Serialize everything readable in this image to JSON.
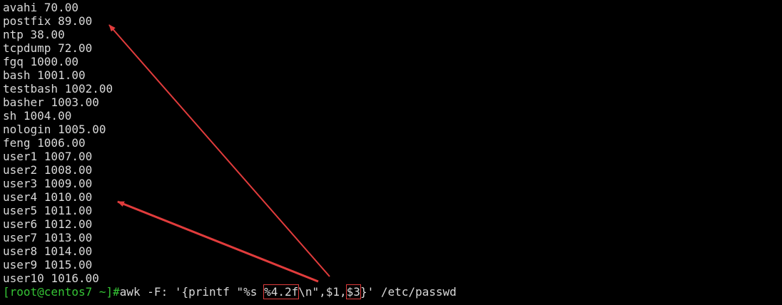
{
  "terminal": {
    "output_lines": [
      "avahi 70.00",
      "postfix 89.00",
      "ntp 38.00",
      "tcpdump 72.00",
      "fgq 1000.00",
      "bash 1001.00",
      "testbash 1002.00",
      "basher 1003.00",
      "sh 1004.00",
      "nologin 1005.00",
      "feng 1006.00",
      "user1 1007.00",
      "user2 1008.00",
      "user3 1009.00",
      "user4 1010.00",
      "user5 1011.00",
      "user6 1012.00",
      "user7 1013.00",
      "user8 1014.00",
      "user9 1015.00",
      "user10 1016.00"
    ],
    "prompt": "[root@centos7 ~]#",
    "command": {
      "part1": "awk -F: '{printf \"%s ",
      "format_spec": "%4.2f",
      "part2": "\\n\",$1,",
      "field_ref": "$3",
      "part3": "}' /etc/passwd"
    }
  },
  "colors": {
    "background": "#000000",
    "text": "#d9d9d9",
    "prompt": "#35c435",
    "annotation": "#e13c3c"
  }
}
